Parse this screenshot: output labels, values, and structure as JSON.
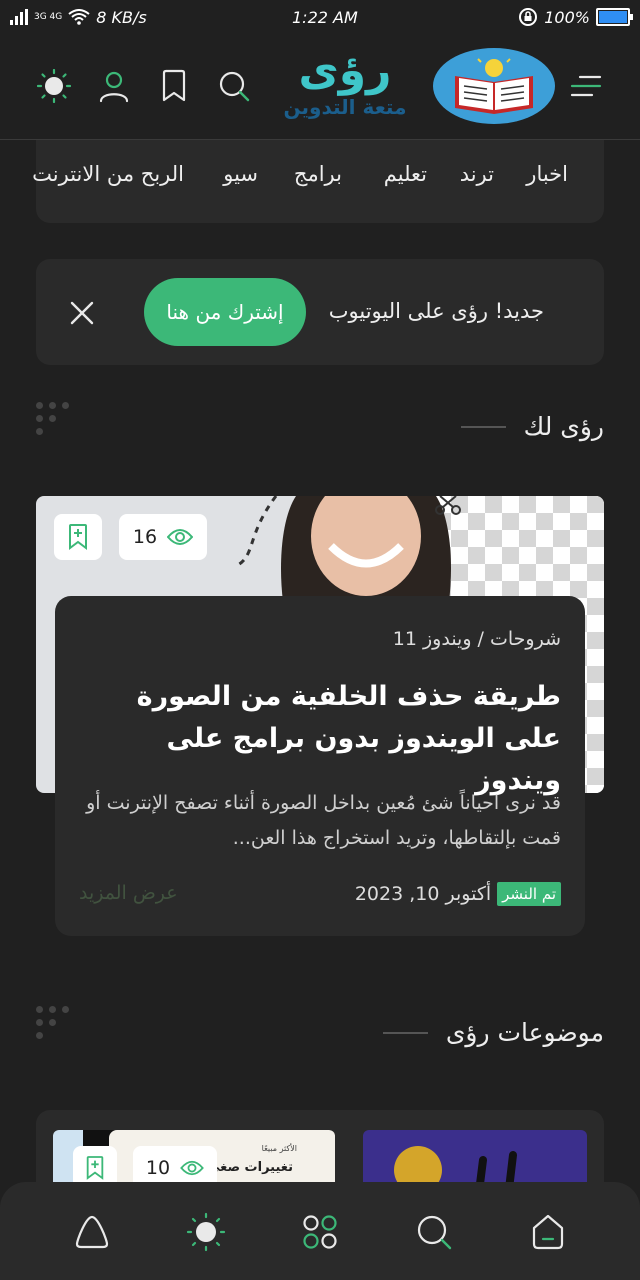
{
  "status_bar": {
    "network": "3G 4G",
    "speed": "8 KB/s",
    "time": "1:22 AM",
    "battery": "100%"
  },
  "header": {
    "logo_name": "رؤى",
    "logo_tagline": "متعة التدوين",
    "icons": [
      "menu-icon",
      "search-icon",
      "bookmark-icon",
      "user-icon",
      "theme-sun-icon"
    ]
  },
  "nav": {
    "items": [
      "اخبار",
      "ترند",
      "تعليم",
      "برامج",
      "سيو",
      "الربح من الانترنت"
    ]
  },
  "notice": {
    "text": "جديد! رؤى على اليوتيوب",
    "button_label": "إشترك من هنا"
  },
  "for_you": {
    "title": "رؤى لك"
  },
  "featured_post": {
    "views": "16",
    "category": "شروحات / ويندوز 11",
    "title": "طريقة حذف الخلفية من الصورة على الويندوز بدون برامج على ويندوز",
    "excerpt": "قد نرى احياناً شئ مُعين بداخل الصورة أثناء تصفح الإنترنت أو قمت بإلتقاطها، وتريد استخراج هذا العن...",
    "published_badge": "تم النشر",
    "date": "أكتوبر 10, 2023",
    "more_label": "عرض المزيد"
  },
  "topics": {
    "title": "موضوعات رؤى",
    "first_card_views": "10",
    "first_card_caption": "تغييرات صغي",
    "first_card_small": "الأكثر مبيعًا"
  },
  "bottom_nav": {
    "icons": [
      "home-icon",
      "search-icon",
      "categories-icon",
      "theme-sun-icon",
      "alert-icon"
    ]
  },
  "colors": {
    "background": "#202020",
    "surface": "#2a2a2a",
    "accent": "#3cb878",
    "logo_teal": "#3fc6c9",
    "logo_blue": "#1b5e8c"
  }
}
